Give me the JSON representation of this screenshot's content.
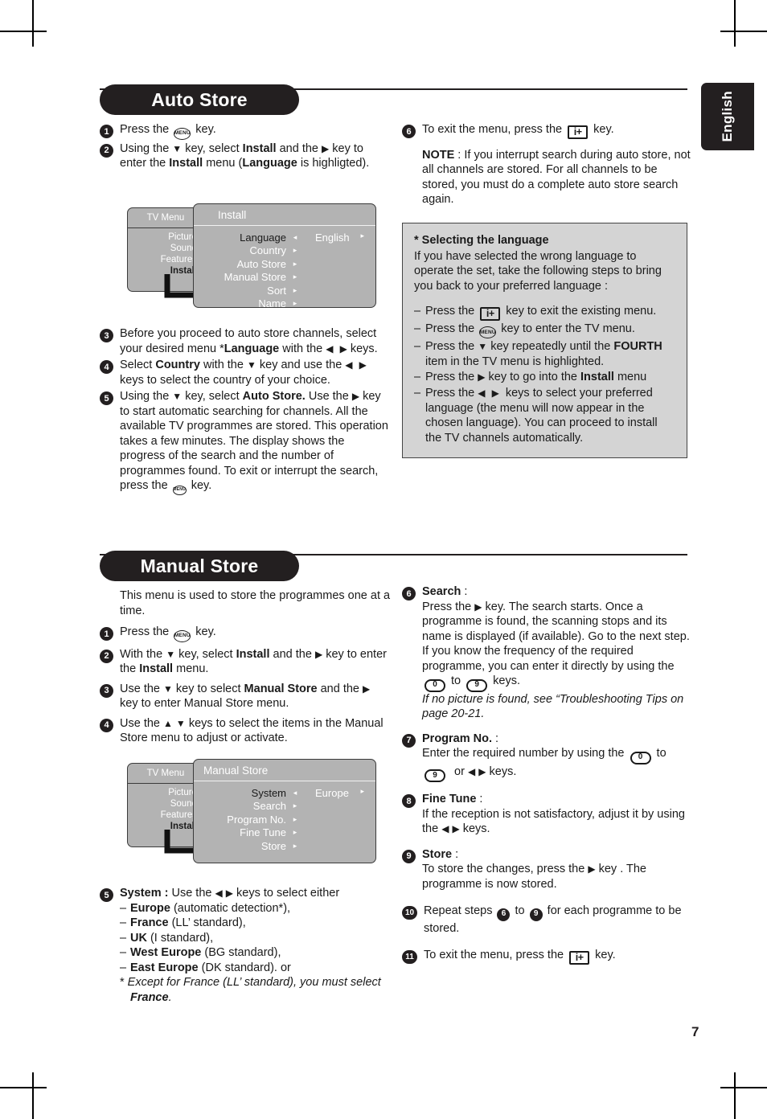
{
  "page": {
    "number": "7",
    "language_tab": "English"
  },
  "sections": [
    {
      "id": "auto-store",
      "title": "Auto Store",
      "left_steps": [
        {
          "num": "1",
          "html": "Press the <span class=\"k-menu\">MENU</span> key."
        },
        {
          "num": "2",
          "html": "Using the <span class=\"ar\">▼</span> key, select <b>Install</b> and the <span class=\"ar\">▶</span> key to enter the <b>Install</b> menu (<b>Language</b> is highligted)."
        },
        {
          "num": "3",
          "html": "Before you proceed to auto store channels, select your desired menu *<b>Language</b> with the <span class=\"ar\">◀</span> &nbsp;<span class=\"ar\">▶</span> keys."
        },
        {
          "num": "4",
          "html": "Select <b>Country</b> with the <span class=\"ar\">▼</span> key and use the <span class=\"ar\">◀</span> &nbsp;<span class=\"ar\">▶</span> keys to select the country of your choice."
        },
        {
          "num": "5",
          "html": "Using the <span class=\"ar\">▼</span> key, select <b>Auto Store.</b> Use the <span class=\"ar\">▶</span> key to start automatic searching for channels. All the available TV programmes are stored. This operation takes a few minutes. The display shows the progress of the search and the number of programmes found. To exit or interrupt the search, press the <span class=\"k-menu sm\">MENU</span> key."
        }
      ],
      "right_steps": [
        {
          "num": "6",
          "html": "To exit the menu, press the <span class=\"k-info\">i+</span> key."
        }
      ],
      "note_inline": "NOTE : If you interrupt search during auto store, not all channels are stored. For all channels to be stored, you must do a complete auto store search again.",
      "osd": {
        "left_title": "TV Menu",
        "left_items": [
          "Picture",
          "Sound",
          "Features",
          "Install"
        ],
        "left_selected": "Install",
        "right_title": "Install",
        "rows": [
          {
            "label": "Language",
            "has_left_arrow": true,
            "value": "English",
            "has_right_arrow": true
          },
          {
            "label": "Country",
            "arrow": "▸"
          },
          {
            "label": "Auto Store",
            "arrow": "▸"
          },
          {
            "label": "Manual Store",
            "arrow": "▸"
          },
          {
            "label": "Sort",
            "arrow": "▸"
          },
          {
            "label": "Name",
            "arrow": "▸"
          }
        ]
      }
    },
    {
      "id": "manual-store",
      "title": "Manual Store",
      "intro": "This menu is used to store the programmes one at a time.",
      "left_steps": [
        {
          "num": "1",
          "html": "Press the <span class=\"k-menu\">MENU</span> key."
        },
        {
          "num": "2",
          "html": "With the <span class=\"ar\">▼</span> key, select <b>Install</b> and the <span class=\"ar\">▶</span> key to enter the <b>Install</b> menu."
        },
        {
          "num": "3",
          "html": "Use the <span class=\"ar\">▼</span> key to select <b>Manual Store</b> and the <span class=\"ar\">▶</span> key to enter Manual Store menu."
        },
        {
          "num": "4",
          "html": "Use the <span class=\"ar\">▲</span> <span class=\"ar\">▼</span> keys to select the items in the Manual Store menu to adjust or activate."
        }
      ],
      "system_step": {
        "num": "5",
        "lead": "<b>System :</b> Use the <span class=\"ar\">◀</span> <span class=\"ar\">▶</span> keys to select either",
        "options": [
          "<b>Europe</b> (automatic detection*),",
          "<b>France</b> (LL’ standard),",
          "<b>UK</b> (I standard),",
          "<b>West Europe</b> (BG standard),",
          "<b>East Europe</b> (DK standard). or"
        ],
        "footnote": "* <i>Except for France (LL’ standard), you must select</i> <b><i>France</i></b><i>.</i>"
      },
      "right_steps": [
        {
          "num": "6",
          "html": "<b>Search</b> :<br>Press the <span class=\"ar\">▶</span> key. The search starts. Once a programme is found, the scanning stops and its name is displayed (if available). Go to the next step. If you know the frequency of the required programme, you can enter it directly by using the <span class=\"k-num\">0</span> to <span class=\"k-num\">9</span> keys.<br><i>If no picture is found, see “Troubleshooting Tips on page 20-21.</i>"
        },
        {
          "num": "7",
          "html": "<b>Program No.</b> :<br>Enter the required number by using the <span class=\"k-num\">0</span> to <span class=\"k-num\">9</span> &nbsp;or <span class=\"ar\">◀</span> <span class=\"ar\">▶</span> keys."
        },
        {
          "num": "8",
          "html": "<b>Fine Tune</b> :<br>If the reception is not satisfactory, adjust it by using the <span class=\"ar\">◀</span> <span class=\"ar\">▶</span> keys."
        },
        {
          "num": "9",
          "html": "<b>Store</b> :<br>To store the changes, press the <span class=\"ar\">▶</span> key . The programme is now stored."
        },
        {
          "num": "10",
          "html": "Repeat steps <span class=\"bullet inline\">6</span> to <span class=\"bullet inline\">9</span> for each programme to be stored."
        },
        {
          "num": "11",
          "html": "To exit the menu, press the <span class=\"k-info\">i+</span> key."
        }
      ],
      "osd": {
        "left_title": "TV Menu",
        "left_items": [
          "Picture",
          "Sound",
          "Features",
          "Install"
        ],
        "left_selected": "Install",
        "right_title": "Manual Store",
        "rows": [
          {
            "label": "System",
            "has_left_arrow": true,
            "value": "Europe",
            "has_right_arrow": true
          },
          {
            "label": "Search",
            "arrow": "▸"
          },
          {
            "label": "Program No.",
            "arrow": "▸"
          },
          {
            "label": "Fine Tune",
            "arrow": "▸"
          },
          {
            "label": "Store",
            "arrow": "▸"
          }
        ]
      }
    }
  ],
  "language_note": {
    "title": "* Selecting the language",
    "intro": "If you have selected the wrong language to operate the set, take the following steps to bring you back to your preferred language :",
    "items": [
      "Press the <span class=\"k-info\">i+</span> key to exit the existing menu.",
      "Press the <span class=\"k-menu\">MENU</span> key to enter the TV menu.",
      "Press the <span class=\"ar\">▼</span> key repeatedly until the <b>FOURTH</b> item in the TV menu is highlighted.",
      "Press the <span class=\"ar\">▶</span> key to go into the <b>Install</b> menu",
      "Press the <span class=\"ar\">◀</span> &nbsp;<span class=\"ar\">▶</span> &nbsp;keys to select your preferred language (the menu will now appear in the chosen language). You can proceed to install the TV channels automatically."
    ]
  }
}
